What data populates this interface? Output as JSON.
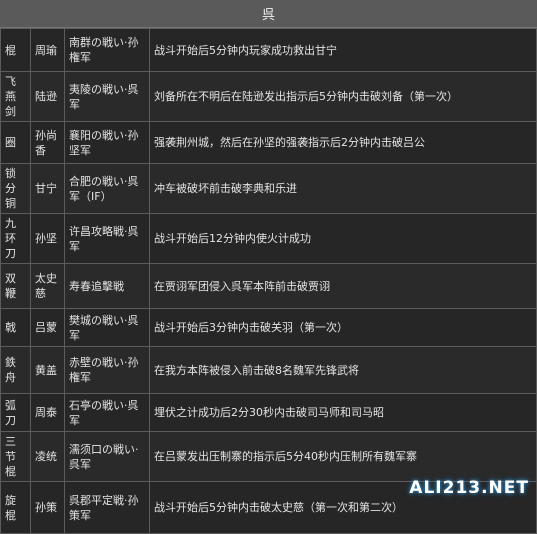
{
  "table": {
    "header": "呉",
    "rows": [
      {
        "weapon": "棍",
        "officer": "周瑜",
        "stage": "南群の戦い·孙権军",
        "condition": "战斗开始后5分钟内玩家成功救出甘宁"
      },
      {
        "weapon": "飞燕剑",
        "officer": "陆逊",
        "stage": "夷陵の戦い·呉军",
        "condition": "刘备所在不明后在陆逊发出指示后5分钟内击破刘备（第一次）"
      },
      {
        "weapon": "圈",
        "officer": "孙尚香",
        "stage": "襄阳の戦い·孙坚军",
        "condition": "强袭荆州城，然后在孙坚的强袭指示后2分钟内击破吕公"
      },
      {
        "weapon": "锁分铜",
        "officer": "甘宁",
        "stage": "合肥の戦い·呉军（IF）",
        "condition": "冲车被破坏前击破李典和乐进"
      },
      {
        "weapon": "九环刀",
        "officer": "孙坚",
        "stage": "许昌攻略戦·呉军",
        "condition": "战斗开始后12分钟内使火计成功"
      },
      {
        "weapon": "双鞭",
        "officer": "太史慈",
        "stage": "寿春追擊戦",
        "condition": "在贾诩军团侵入呉军本阵前击破贾诩"
      },
      {
        "weapon": "戟",
        "officer": "吕蒙",
        "stage": "樊城の戦い·呉军",
        "condition": "战斗开始后3分钟内击破关羽（第一次）"
      },
      {
        "weapon": "鉄舟",
        "officer": "黄盖",
        "stage": "赤壁の戦い·孙権军",
        "condition": "在我方本阵被侵入前击破8名魏军先锋武将"
      },
      {
        "weapon": "弧刀",
        "officer": "周泰",
        "stage": "石亭の戦い·呉军",
        "condition": "埋伏之计成功后2分30秒内击破司马师和司马昭"
      },
      {
        "weapon": "三节棍",
        "officer": "凌统",
        "stage": "濡须口の戦い·呉军",
        "condition": "在吕蒙发出压制寨的指示后5分40秒内压制所有魏军寨"
      },
      {
        "weapon": "旋棍",
        "officer": "孙策",
        "stage": "呉郡平定戦·孙策军",
        "condition": "战斗开始后5分钟内击破太史慈（第一次和第二次）"
      }
    ]
  },
  "watermark": "ALI213.NET"
}
